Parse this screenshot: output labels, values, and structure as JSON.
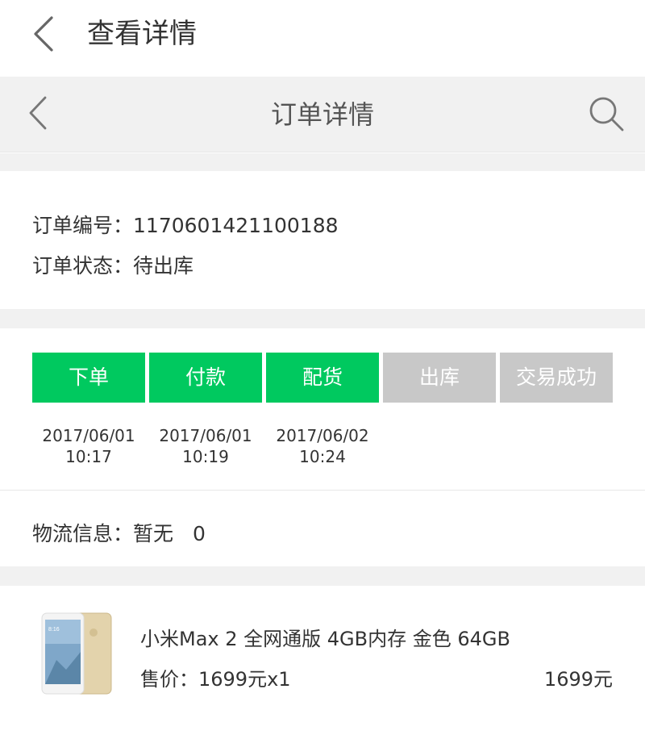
{
  "app_header": {
    "title": "查看详情"
  },
  "web_nav": {
    "title": "订单详情"
  },
  "order_info": {
    "number_label": "订单编号：",
    "number": "1170601421100188",
    "status_label": "订单状态：",
    "status": "待出库"
  },
  "progress": {
    "steps": [
      {
        "label": "下单",
        "date": "2017/06/01",
        "time": "10:17",
        "state": "done"
      },
      {
        "label": "付款",
        "date": "2017/06/01",
        "time": "10:19",
        "state": "done"
      },
      {
        "label": "配货",
        "date": "2017/06/02",
        "time": "10:24",
        "state": "done"
      },
      {
        "label": "出库",
        "date": "",
        "time": "",
        "state": "todo"
      },
      {
        "label": "交易成功",
        "date": "",
        "time": "",
        "state": "todo"
      }
    ],
    "colors": {
      "done": "#00c95f",
      "todo": "#c8c8c8"
    }
  },
  "logistics": {
    "label": "物流信息：",
    "value": "暂无",
    "count": "0"
  },
  "product": {
    "name": "小米Max 2 全网通版 4GB内存 金色 64GB",
    "price_label": "售价：",
    "price": "1699元x1",
    "total": "1699元",
    "image_icon": "phone-product-image"
  }
}
